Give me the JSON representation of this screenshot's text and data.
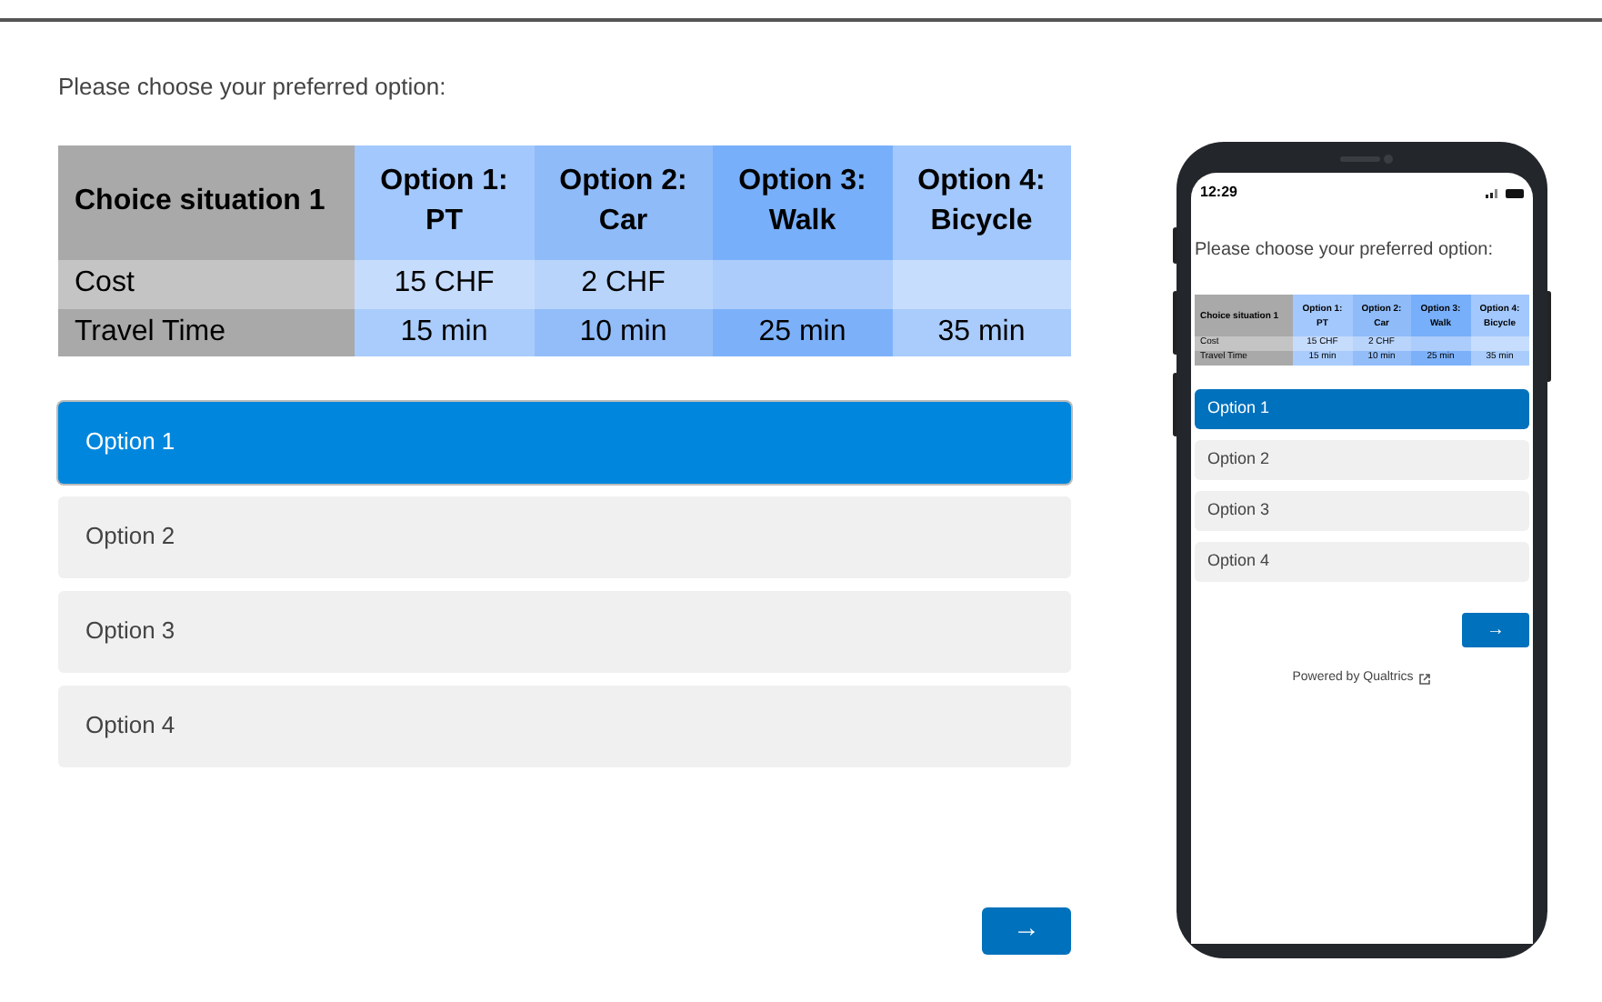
{
  "survey": {
    "question": "Please choose your preferred option:",
    "table": {
      "corner": "Choice situation 1",
      "columns": [
        {
          "title": "Option 1:",
          "mode": "PT"
        },
        {
          "title": "Option 2:",
          "mode": "Car"
        },
        {
          "title": "Option 3:",
          "mode": "Walk"
        },
        {
          "title": "Option 4:",
          "mode": "Bicycle"
        }
      ],
      "rows": [
        {
          "label": "Cost",
          "cells": [
            "15 CHF",
            "2 CHF",
            null,
            null
          ]
        },
        {
          "label": "Travel Time",
          "cells": [
            "15 min",
            "10 min",
            "25 min",
            "35 min"
          ]
        }
      ]
    },
    "options": [
      {
        "label": "Option 1",
        "selected": true
      },
      {
        "label": "Option 2",
        "selected": false
      },
      {
        "label": "Option 3",
        "selected": false
      },
      {
        "label": "Option 4",
        "selected": false
      }
    ],
    "next_button": "→"
  },
  "phone": {
    "time": "12:29",
    "question": "Please choose your preferred option:",
    "table": {
      "corner": "Choice situation 1",
      "columns": [
        {
          "title": "Option 1:",
          "mode": "PT"
        },
        {
          "title": "Option 2:",
          "mode": "Car"
        },
        {
          "title": "Option 3:",
          "mode": "Walk"
        },
        {
          "title": "Option 4:",
          "mode": "Bicycle"
        }
      ],
      "rows": [
        {
          "label": "Cost",
          "cells": [
            "15 CHF",
            "2 CHF",
            null,
            null
          ]
        },
        {
          "label": "Travel Time",
          "cells": [
            "15 min",
            "10 min",
            "25 min",
            "35 min"
          ]
        }
      ]
    },
    "options": [
      {
        "label": "Option 1",
        "selected": true
      },
      {
        "label": "Option 2",
        "selected": false
      },
      {
        "label": "Option 3",
        "selected": false
      },
      {
        "label": "Option 4",
        "selected": false
      }
    ],
    "next_button": "→",
    "footer": "Powered by Qualtrics"
  }
}
